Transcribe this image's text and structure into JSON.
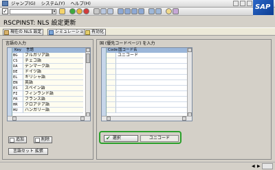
{
  "menu": {
    "items": [
      "ジャンプ(G)",
      "システム(Y)",
      "ヘルプ(H)"
    ]
  },
  "brand": {
    "logo_text": "SAP"
  },
  "toolbar": {
    "icons": [
      "save-icon",
      "back-icon",
      "exit-icon",
      "cancel-icon",
      "print-icon",
      "find-icon",
      "find-next-icon",
      "first-page-icon",
      "prev-page-icon",
      "next-page-icon",
      "last-page-icon",
      "new-session-icon",
      "shortcut-icon",
      "help-icon",
      "customize-icon"
    ]
  },
  "title": "RSCPINST: NLS 設定更新",
  "app_toolbar": {
    "current_nls": "現在の NLS 設定",
    "simulation": "シミュレーション",
    "activate": "有効化"
  },
  "left_panel": {
    "title": "言語の入力",
    "columns": {
      "key": "Key",
      "name": "言語"
    },
    "rows": [
      {
        "key": "BG",
        "name": "ブルガリア語"
      },
      {
        "key": "CS",
        "name": "チェコ語"
      },
      {
        "key": "DA",
        "name": "デンマーク語"
      },
      {
        "key": "DE",
        "name": "ドイツ語"
      },
      {
        "key": "EL",
        "name": "ギリシャ語"
      },
      {
        "key": "EN",
        "name": "英語"
      },
      {
        "key": "ES",
        "name": "スペイン語"
      },
      {
        "key": "FI",
        "name": "フィンランド語"
      },
      {
        "key": "FR",
        "name": "フランス語"
      },
      {
        "key": "HR",
        "name": "クロアテア語"
      },
      {
        "key": "HU",
        "name": "ハンガリー語"
      }
    ],
    "add_label": "追加",
    "delete_label": "削除",
    "extend_label": "言語セット 拡張"
  },
  "right_panel": {
    "title": "国 (優先コードページ) を入力",
    "columns": {
      "code": "Code",
      "name": "国コード名"
    },
    "rows": [
      {
        "code": "",
        "name": "ユニコード"
      }
    ],
    "select_label": "選択",
    "unicode_value": "ユニコード"
  },
  "colors": {
    "highlight": "#2aa02a",
    "header": "#9bb6d9"
  }
}
